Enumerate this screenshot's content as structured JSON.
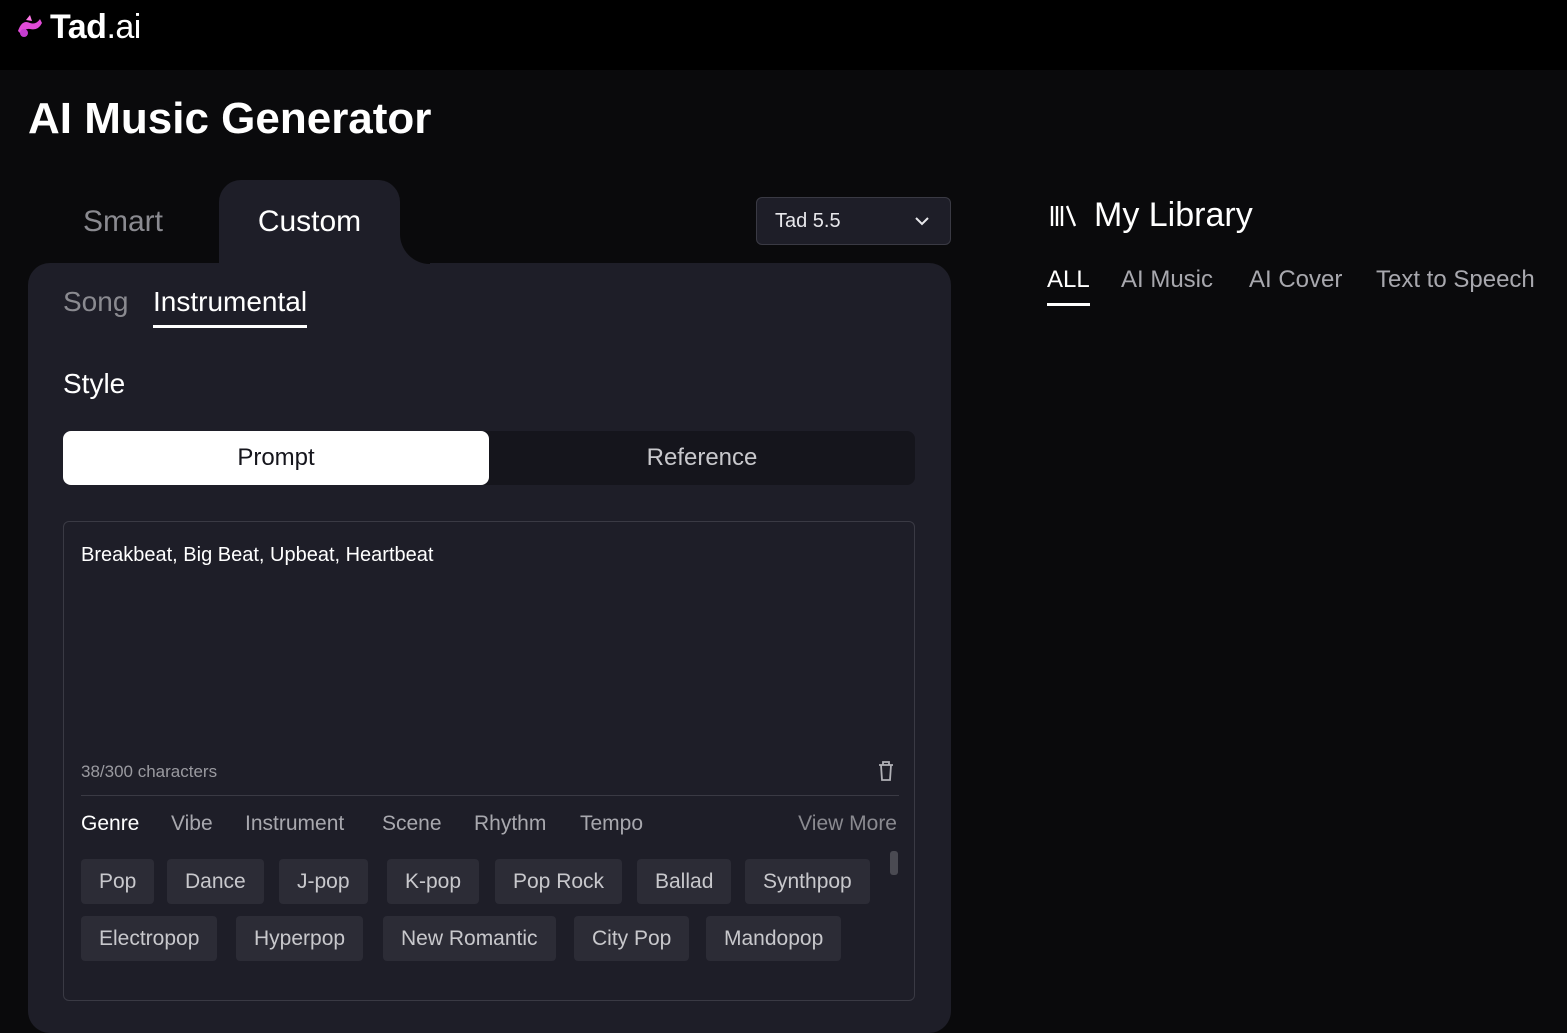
{
  "brand": {
    "name": "Tad",
    "suffix": ".ai",
    "accent": "#e14bd8"
  },
  "page_title": "AI Music Generator",
  "mode_tabs": [
    {
      "label": "Smart",
      "active": false
    },
    {
      "label": "Custom",
      "active": true
    }
  ],
  "version_select": {
    "value": "Tad 5.5"
  },
  "sub_tabs": [
    {
      "label": "Song",
      "active": false
    },
    {
      "label": "Instrumental",
      "active": true
    }
  ],
  "style": {
    "label": "Style",
    "segments": [
      {
        "label": "Prompt",
        "active": true
      },
      {
        "label": "Reference",
        "active": false
      }
    ],
    "prompt_value": "Breakbeat, Big Beat, Upbeat, Heartbeat",
    "char_count": "38/300 characters"
  },
  "categories": {
    "tabs": [
      "Genre",
      "Vibe",
      "Instrument",
      "Scene",
      "Rhythm",
      "Tempo"
    ],
    "active": "Genre",
    "view_more": "View More"
  },
  "chips": [
    "Pop",
    "Dance",
    "J-pop",
    "K-pop",
    "Pop Rock",
    "Ballad",
    "Synthpop",
    "Electropop",
    "Hyperpop",
    "New Romantic",
    "City Pop",
    "Mandopop"
  ],
  "library": {
    "icon": "library-icon",
    "title": "My Library",
    "tabs": [
      {
        "label": "ALL",
        "active": true
      },
      {
        "label": "AI Music",
        "active": false
      },
      {
        "label": "AI Cover",
        "active": false
      },
      {
        "label": "Text to Speech",
        "active": false
      }
    ]
  }
}
